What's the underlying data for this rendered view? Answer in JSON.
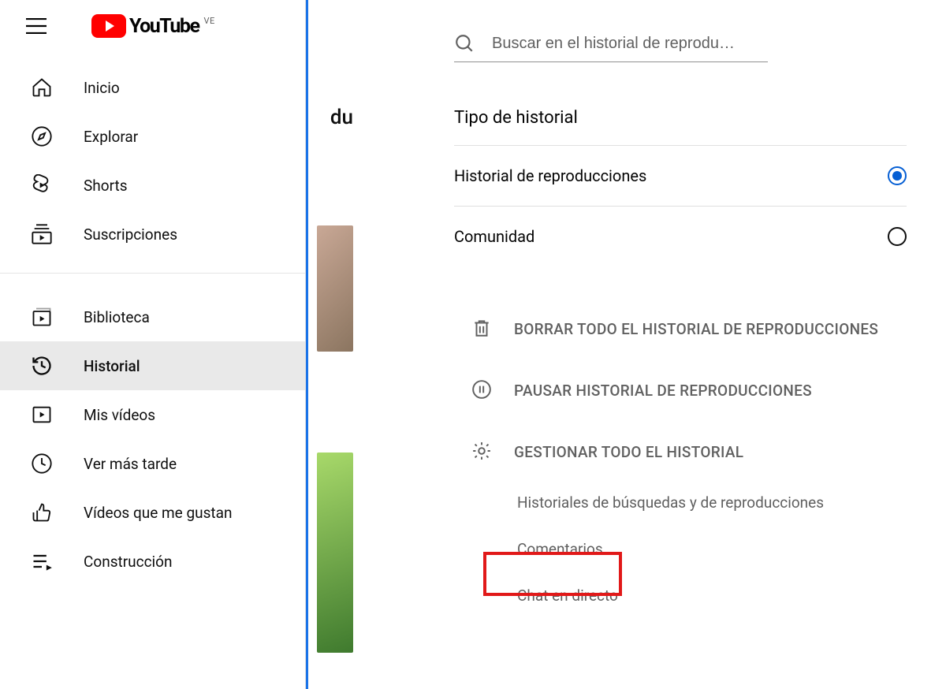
{
  "header": {
    "brand": "YouTube",
    "country_code": "VE"
  },
  "sidebar": {
    "section1": [
      {
        "id": "home",
        "label": "Inicio"
      },
      {
        "id": "explore",
        "label": "Explorar"
      },
      {
        "id": "shorts",
        "label": "Shorts"
      },
      {
        "id": "subscriptions",
        "label": "Suscripciones"
      }
    ],
    "section2": [
      {
        "id": "library",
        "label": "Biblioteca"
      },
      {
        "id": "history",
        "label": "Historial",
        "active": true
      },
      {
        "id": "my-videos",
        "label": "Mis vídeos"
      },
      {
        "id": "watch-later",
        "label": "Ver más tarde"
      },
      {
        "id": "liked",
        "label": "Vídeos que me gustan"
      },
      {
        "id": "playlist",
        "label": "Construcción"
      }
    ]
  },
  "mid": {
    "chip_partial": "du"
  },
  "panel": {
    "search_placeholder": "Buscar en el historial de reprodu…",
    "type_heading": "Tipo de historial",
    "type_options": [
      {
        "id": "watch",
        "label": "Historial de reproducciones",
        "selected": true
      },
      {
        "id": "community",
        "label": "Comunidad",
        "selected": false
      }
    ],
    "actions": [
      {
        "id": "clear",
        "label": "Borrar todo el historial de reproducciones"
      },
      {
        "id": "pause",
        "label": "Pausar historial de reproducciones"
      },
      {
        "id": "manage",
        "label": "Gestionar todo el historial"
      }
    ],
    "sub_links": [
      {
        "id": "search-watch",
        "label": "Historiales de búsquedas y de reproducciones"
      },
      {
        "id": "comments",
        "label": "Comentarios"
      },
      {
        "id": "live-chat",
        "label": "Chat en directo"
      }
    ]
  },
  "colors": {
    "brand_red": "#ff0000",
    "highlight_red": "#e11919",
    "accent_blue": "#065fd4"
  }
}
